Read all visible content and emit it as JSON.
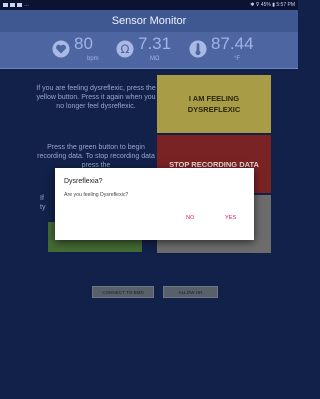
{
  "status_bar": {
    "right_text": "✱ ⊽ 45% ▮ 5:57 PM"
  },
  "header": {
    "title": "Sensor Monitor"
  },
  "vitals": {
    "heart": {
      "value": "80",
      "unit": "bpm",
      "icon": "heart-icon"
    },
    "resistance": {
      "value": "7.31",
      "unit": "MΩ",
      "icon": "omega-icon"
    },
    "temperature": {
      "value": "87.44",
      "unit": "°F",
      "icon": "thermometer-icon"
    }
  },
  "panels": {
    "dysreflexia_text": "If you are feeling dysreflexic, press the yellow button. Press it again when you no longer feel dysreflexic.",
    "recording_text": "Press the green button to begin recording data. To stop recording data press the",
    "partial_left_text": "If\nty"
  },
  "buttons": {
    "feeling_dysreflexic": "I AM FEELING DYSREFLEXIC",
    "stop_recording": "STOP RECORDING DATA",
    "connect_to_bmd": "CONNECT TO BMD",
    "allow_hr": "ALLOW HR"
  },
  "dialog": {
    "title": "Dysreflexia?",
    "message": "Are you feeling Dysreflexic?",
    "no_label": "NO",
    "yes_label": "YES"
  },
  "colors": {
    "background": "#12214a",
    "title_bar": "#3f5892",
    "vitals_bar": "#4d66a2",
    "yellow_button": "#a99c47",
    "red_button": "#7a2325",
    "gray_button": "#6c6c6c",
    "green_button": "#446a34",
    "dialog_accent": "#e0175a"
  }
}
